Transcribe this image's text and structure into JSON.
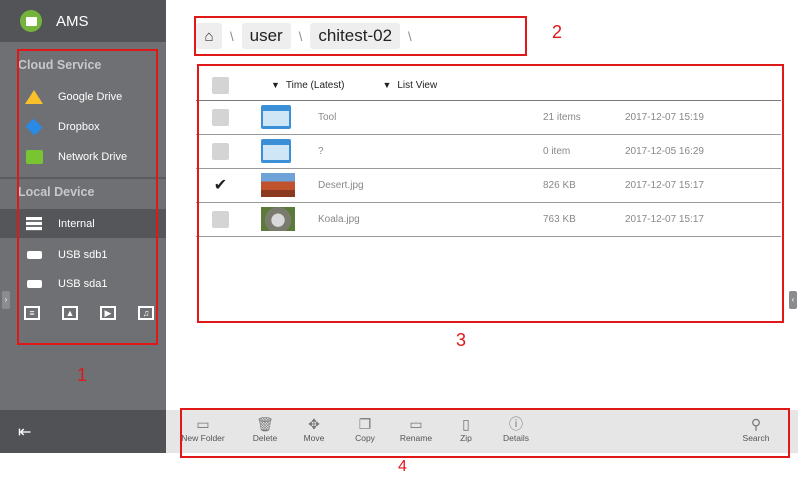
{
  "app": {
    "title": "AMS"
  },
  "sidebar": {
    "cloud_header": "Cloud Service",
    "cloud_items": [
      {
        "label": "Google Drive",
        "icon": "google-drive-icon"
      },
      {
        "label": "Dropbox",
        "icon": "dropbox-icon"
      },
      {
        "label": "Network Drive",
        "icon": "network-drive-icon"
      }
    ],
    "local_header": "Local Device",
    "local_items": [
      {
        "label": "Internal",
        "icon": "storage-icon",
        "active": true
      },
      {
        "label": "USB sdb1",
        "icon": "usb-icon"
      },
      {
        "label": "USB sda1",
        "icon": "usb-icon"
      }
    ],
    "media_filters": [
      "document-icon",
      "image-icon",
      "video-icon",
      "music-icon"
    ]
  },
  "breadcrumb": {
    "items": [
      "user",
      "chitest-02"
    ],
    "separator": "\\"
  },
  "list": {
    "sort_label": "Time (Latest)",
    "view_label": "List View",
    "rows": [
      {
        "name": "Tool",
        "size": "21 items",
        "date": "2017-12-07  15:19",
        "checked": false,
        "type": "folder"
      },
      {
        "name": "?",
        "size": "0 item",
        "date": "2017-12-05  16:29",
        "checked": false,
        "type": "folder"
      },
      {
        "name": "Desert.jpg",
        "size": "826 KB",
        "date": "2017-12-07  15:17",
        "checked": true,
        "type": "image"
      },
      {
        "name": "Koala.jpg",
        "size": "763 KB",
        "date": "2017-12-07  15:17",
        "checked": false,
        "type": "image"
      }
    ]
  },
  "toolbar": {
    "new_folder": "New Folder",
    "delete": "Delete",
    "move": "Move",
    "copy": "Copy",
    "rename": "Rename",
    "zip": "Zip",
    "details": "Details",
    "search": "Search"
  },
  "annotations": {
    "one": "1",
    "two": "2",
    "three": "3",
    "four": "4"
  },
  "colors": {
    "annotation": "#e01818",
    "sidebar": "#6e7073",
    "folder": "#3a8fd6"
  }
}
